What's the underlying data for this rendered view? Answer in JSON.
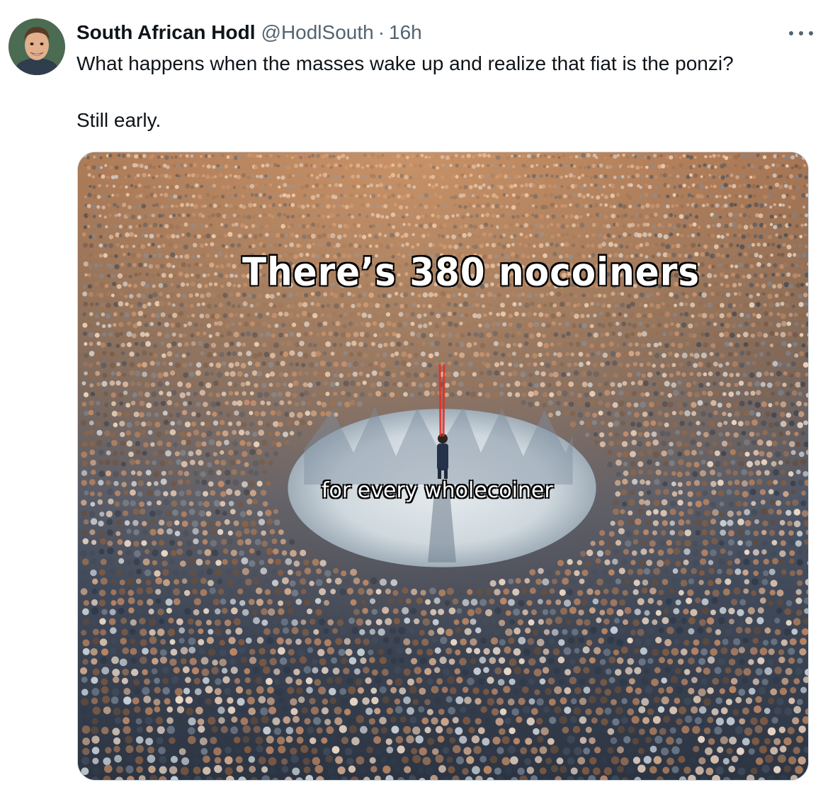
{
  "tweet": {
    "author": {
      "display_name": "South African Hodl",
      "handle": "@HodlSouth",
      "separator": "·",
      "time": "16h",
      "avatar_icon": "profile-photo"
    },
    "text": {
      "line1": "What happens when the masses wake up and realize that fiat is the ponzi?",
      "line2": "Still early."
    },
    "more_icon": "more-horizontal-icon",
    "media": {
      "caption_top": "There’s 380 nocoiners",
      "caption_bottom": "for every wholecoiner"
    }
  },
  "colors": {
    "text_primary": "#0f1419",
    "text_secondary": "#536471",
    "border": "#cfd9de",
    "laser": "#e0322a"
  }
}
